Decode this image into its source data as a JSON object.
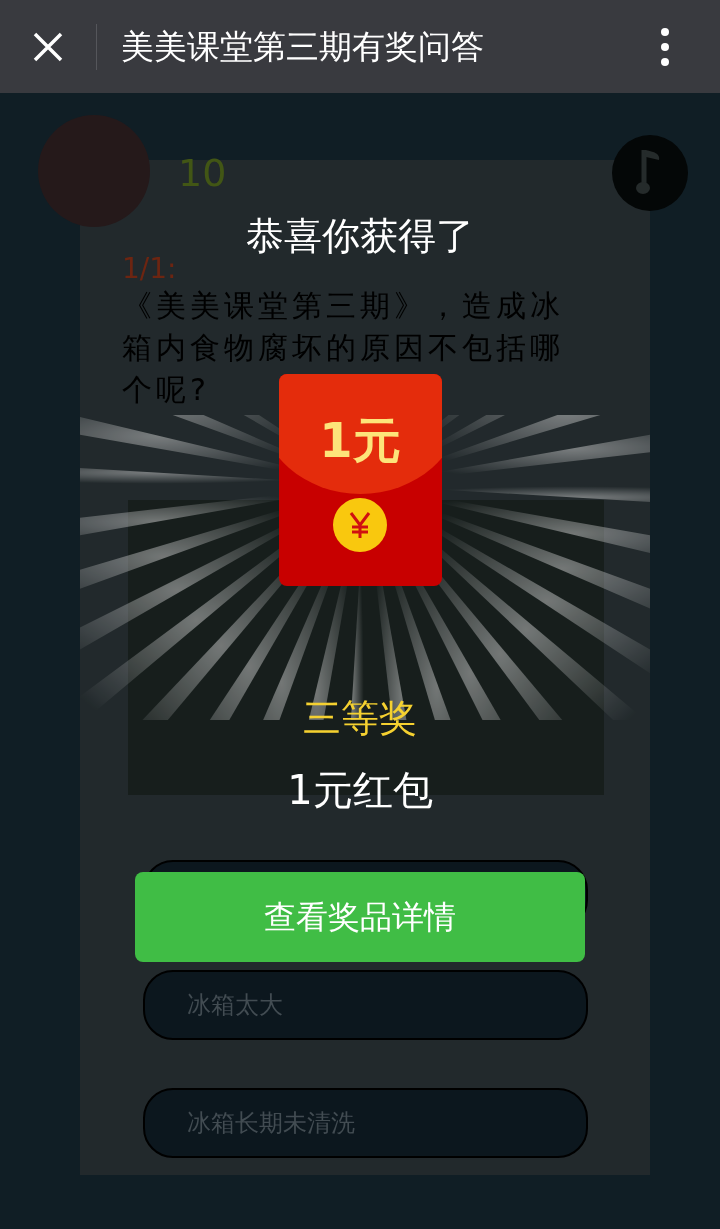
{
  "header": {
    "title": "美美课堂第三期有奖问答"
  },
  "quiz": {
    "score": "10",
    "question_number": "1/1:",
    "question": "《美美课堂第三期》，造成冰箱内食物腐坏的原因不包括哪个呢?",
    "options": [
      {
        "label": "冰箱太大"
      },
      {
        "label": "冰箱长期未清洗"
      }
    ]
  },
  "prize_popup": {
    "heading": "恭喜你获得了",
    "envelope_amount": "1元",
    "prize_level": "三等奖",
    "prize_name": "1元红包",
    "button": "查看奖品详情"
  }
}
